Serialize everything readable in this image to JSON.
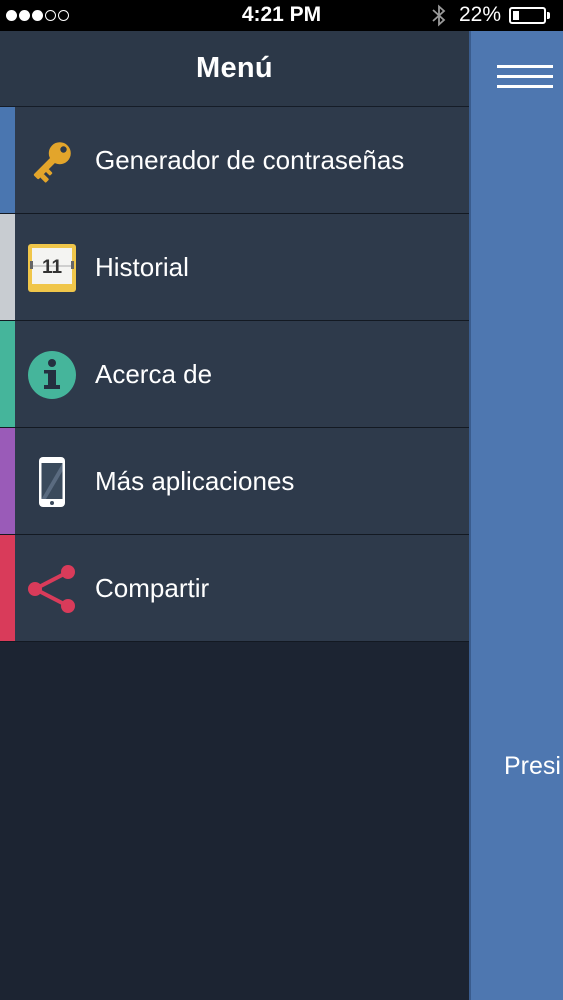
{
  "status_bar": {
    "signal": [
      true,
      true,
      true,
      false,
      false
    ],
    "time": "4:21 PM",
    "battery_percent_text": "22%",
    "battery_level": 0.22,
    "bluetooth_icon": "bluetooth-icon"
  },
  "menu": {
    "title": "Menú",
    "items": [
      {
        "label": "Generador de contraseñas",
        "icon": "key-icon",
        "color": "#4a76b0"
      },
      {
        "label": "Historial",
        "icon": "calendar-icon",
        "icon_text": "11",
        "color": "#c8ccd1"
      },
      {
        "label": "Acerca de",
        "icon": "info-icon",
        "color": "#45b59b"
      },
      {
        "label": "Más aplicaciones",
        "icon": "smartphone-icon",
        "color": "#9a5bb8"
      },
      {
        "label": "Compartir",
        "icon": "share-icon",
        "color": "#d93b5a"
      }
    ]
  },
  "main_panel": {
    "background": "#4e77b0",
    "text": "Presi",
    "menu_icon": "hamburger-menu-icon"
  }
}
